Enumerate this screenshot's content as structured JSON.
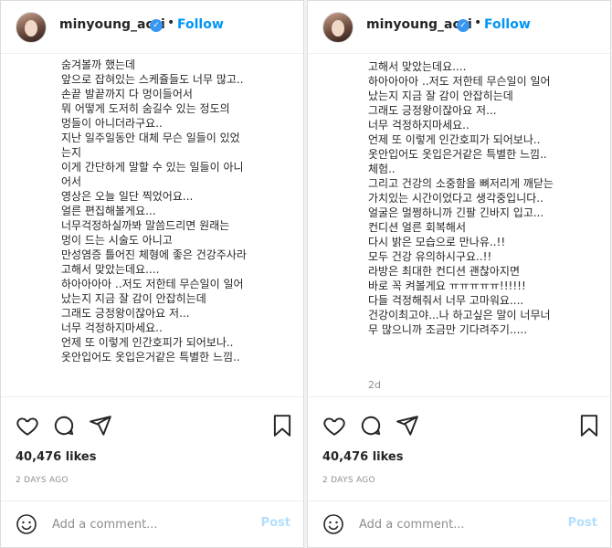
{
  "post": {
    "username": "minyoung_aori",
    "verified_glyph": "✓",
    "separator": "•",
    "follow_label": "Follow",
    "likes": "40,476 likes",
    "date": "2 DAYS AGO",
    "comment_placeholder": "Add a comment...",
    "post_label": "Post",
    "icons": [
      "heart-icon",
      "comment-icon",
      "share-icon",
      "bookmark-icon",
      "emoji-icon",
      "verified-icon"
    ]
  },
  "left_caption": [
    "숨겨볼까 했는데",
    "앞으로 잡혀있는 스케쥴들도 너무 많고..",
    "손끝 발끝까지 다 멍이들어서",
    "뭐 어떻게 도저히 숨길수 있는 정도의",
    "멍들이 아니더라구요..",
    "지난 일주일동안 대체 무슨 일들이 있었",
    "는지",
    "이게 간단하게 말할 수 있는 일들이 아니",
    "어서",
    "영상은 오늘 일단 찍었어요...",
    "얼른 편집해볼게요...",
    "너무걱정하실까봐 말씀드리면 원래는",
    "멍이 드는 시술도 아니고",
    "만성염증 틀어진 체형에 좋은 건강주사라",
    "고해서 맞았는데요....",
    "하아아아아 ..저도 저한테 무슨일이 일어",
    "났는지 지금 잘 감이 안잡히는데",
    "그래도 긍정왕이잖아요 저...",
    "너무 걱정하지마세요..",
    "언제 또 이렇게 인간호피가 되어보나..",
    "옷안입어도 옷입은거같은 특별한 느낌.."
  ],
  "right_caption": [
    "고해서 맞았는데요....",
    "하아아아아 ..저도 저한테 무슨일이 일어",
    "났는지 지금 잘 감이 안잡히는데",
    "그래도 긍정왕이잖아요 저...",
    "너무 걱정하지마세요..",
    "언제 또 이렇게 인간호피가 되어보나..",
    "옷안입어도 옷입은거같은 특별한 느낌..",
    "체험..",
    "그리고 건강의 소중함을 뼈저리게 깨닫는",
    "가치있는 시간이었다고 생각중입니다..",
    "얼굴은 멀쩡하니까 긴팔 긴바지 입고...",
    "컨디션 얼른 회복해서",
    "다시 밝은 모습으로 만나유..!!",
    "모두 건강 유의하시구요..!!",
    "라방은 최대한 컨디션 괜찮아지면",
    "바로 꼭 켜볼게요 ㅠㅠㅠㅠㅠ!!!!!!",
    "다들 걱정해줘서 너무 고마워요....",
    "건강이최고야...나 하고싶은 말이 너무너",
    "무 많으니까 조금만 기다려주기....."
  ],
  "right_time_ago": "2d"
}
